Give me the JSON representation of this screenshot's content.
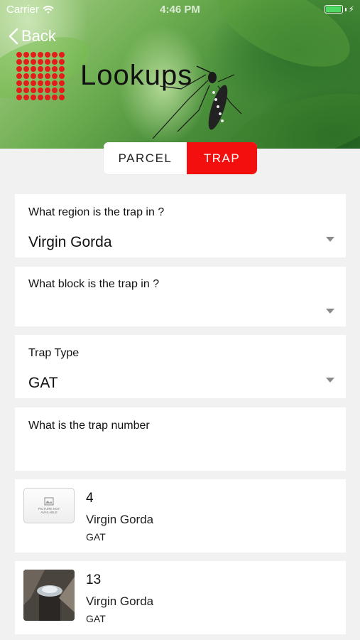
{
  "status_bar": {
    "carrier": "Carrier",
    "time": "4:46 PM"
  },
  "header": {
    "back_label": "Back",
    "title": "Lookups",
    "logo_color": "#e41c1c"
  },
  "segmented": {
    "options": [
      "PARCEL",
      "TRAP"
    ],
    "selected": "TRAP",
    "accent_color": "#f40f0f"
  },
  "form": {
    "region": {
      "label": "What region is the trap in ?",
      "value": "Virgin Gorda"
    },
    "block": {
      "label": "What block is the trap in ?",
      "value": ""
    },
    "trap_type": {
      "label": "Trap Type",
      "value": "GAT"
    },
    "trap_number": {
      "label": "What is the trap number",
      "value": ""
    }
  },
  "results": [
    {
      "number": "4",
      "region": "Virgin Gorda",
      "type": "GAT",
      "thumbnail": "picture-not-available",
      "thumb_text": "PICTURE NOT AVAILABLE"
    },
    {
      "number": "13",
      "region": "Virgin Gorda",
      "type": "GAT",
      "thumbnail": "trap-photo"
    }
  ]
}
